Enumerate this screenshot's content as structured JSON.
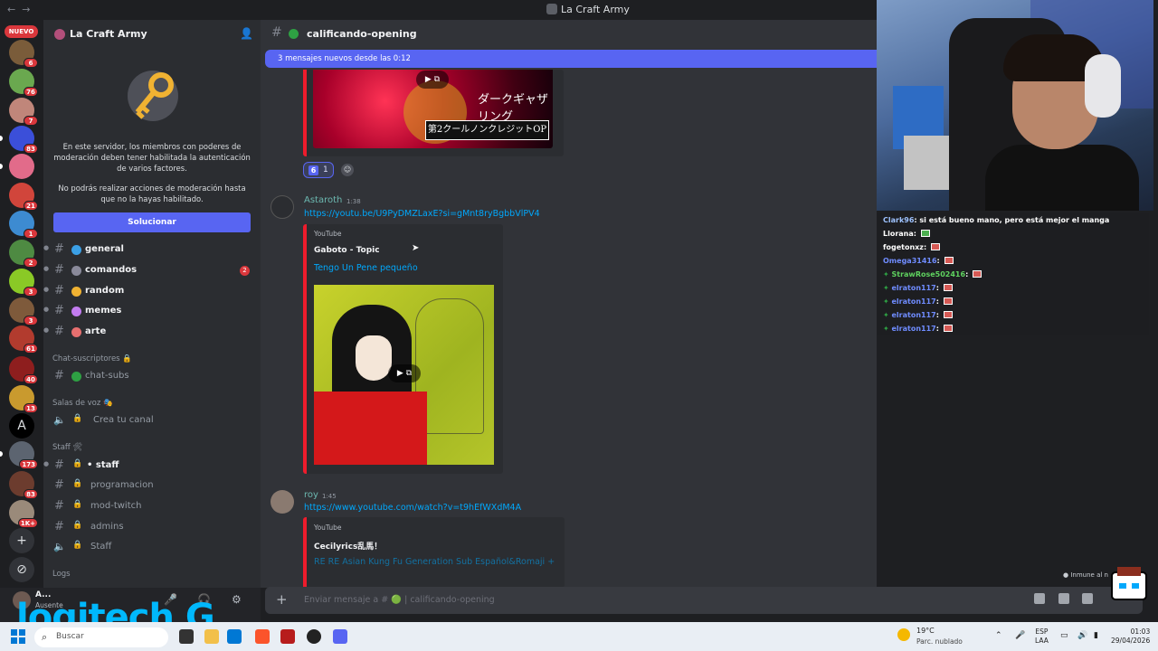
{
  "window": {
    "title": "La Craft Army",
    "nav_back": "←",
    "nav_fwd": "→"
  },
  "guilds": {
    "new_badge": "NUEVO",
    "badges": [
      "6",
      "76",
      "7",
      "83",
      "",
      "21",
      "1",
      "2",
      "3",
      "3",
      "61",
      "40",
      "13",
      "",
      "173",
      "83",
      "1K+"
    ],
    "add_server": "+",
    "discover": "⊘"
  },
  "server": {
    "name": "La Craft Army",
    "mod_notice_1": "En este servidor, los miembros con poderes de moderación deben tener habilitada la autenticación de varios factores.",
    "mod_notice_2": "No podrás realizar acciones de moderación hasta que no la hayas habilitado.",
    "solve_button": "Solucionar"
  },
  "channels": [
    {
      "name": "general",
      "emoji_color": "#3ba0e6"
    },
    {
      "name": "comandos",
      "emoji_color": "#8a8a9a",
      "count": "2"
    },
    {
      "name": "random",
      "emoji_color": "#f0b232"
    },
    {
      "name": "memes",
      "emoji_color": "#c27cf0"
    },
    {
      "name": "arte",
      "emoji_color": "#e76f6f"
    }
  ],
  "categories": {
    "subs": "Chat-suscriptores 🔒",
    "voice": "Salas de voz 🎭",
    "staff": "Staff 🛠",
    "logs": "Logs"
  },
  "subs_channel": "chat-subs",
  "voice_channel": "Crea tu canal",
  "staff_channels": [
    "• staff",
    "programacion",
    "mod-twitch",
    "admins",
    "Staff"
  ],
  "user": {
    "name": "A...",
    "status": "Ausente"
  },
  "overlay_logo": "logitech G",
  "channel": {
    "name": "calificando-opening"
  },
  "new_messages_bar": "3 mensajes nuevos desde las 0:12",
  "top_video": {
    "jp_title": "ダークギャザリング",
    "jp_sub": "第2クールノンクレジットOP"
  },
  "reaction": {
    "emoji": "6",
    "count": "1"
  },
  "messages": [
    {
      "author": "Astaroth",
      "time": "1:38",
      "link": "https://youtu.be/U9PyDMZLaxE?si=gMnt8ryBgbbVlPV4",
      "embed": {
        "provider": "YouTube",
        "author": "Gaboto - Topic",
        "title": "Tengo Un Pene pequeño"
      }
    },
    {
      "author": "roy",
      "time": "1:45",
      "link": "https://www.youtube.com/watch?v=t9hEfWXdM4A",
      "embed": {
        "provider": "YouTube",
        "author": "Cecilyrics乱馬！",
        "title": "RE RE Asian Kung Fu Generation Sub Español&Romaji +"
      }
    }
  ],
  "composer": {
    "placeholder": "Enviar mensaje a # 🟢 | calificando-opening",
    "plus": "+"
  },
  "stream_chat": [
    {
      "user": "Clark96",
      "color": "#9ec2ff",
      "text": ": si está bueno mano, pero está mejor el manga"
    },
    {
      "user": "Llorana",
      "color": "#ffffff",
      "text": ": "
    },
    {
      "user": "fogetonxz",
      "color": "#ffffff",
      "text": ": "
    },
    {
      "user": "Omega31416",
      "color": "#6f8cff",
      "text": ": "
    },
    {
      "user": "StrawRose502416",
      "color": "#5fd25f",
      "text": ": ",
      "badge": true
    },
    {
      "user": "elraton117",
      "color": "#6f8cff",
      "text": ": ",
      "badge": true
    },
    {
      "user": "elraton117",
      "color": "#6f8cff",
      "text": ": ",
      "badge": true
    },
    {
      "user": "elraton117",
      "color": "#6f8cff",
      "text": ": ",
      "badge": true
    },
    {
      "user": "elraton117",
      "color": "#6f8cff",
      "text": ": ",
      "badge": true
    }
  ],
  "immune_label": "Inmune al n",
  "taskbar": {
    "search": "Buscar",
    "weather_temp": "19°C",
    "weather_desc": "Parc. nublado",
    "lang_1": "ESP",
    "lang_2": "LAA",
    "time": "01:03",
    "date": "29/04/2026"
  },
  "colors": {
    "accent": "#5865f2",
    "danger": "#da373c",
    "link": "#00a8fc",
    "youtube": "#ee1c2c"
  }
}
